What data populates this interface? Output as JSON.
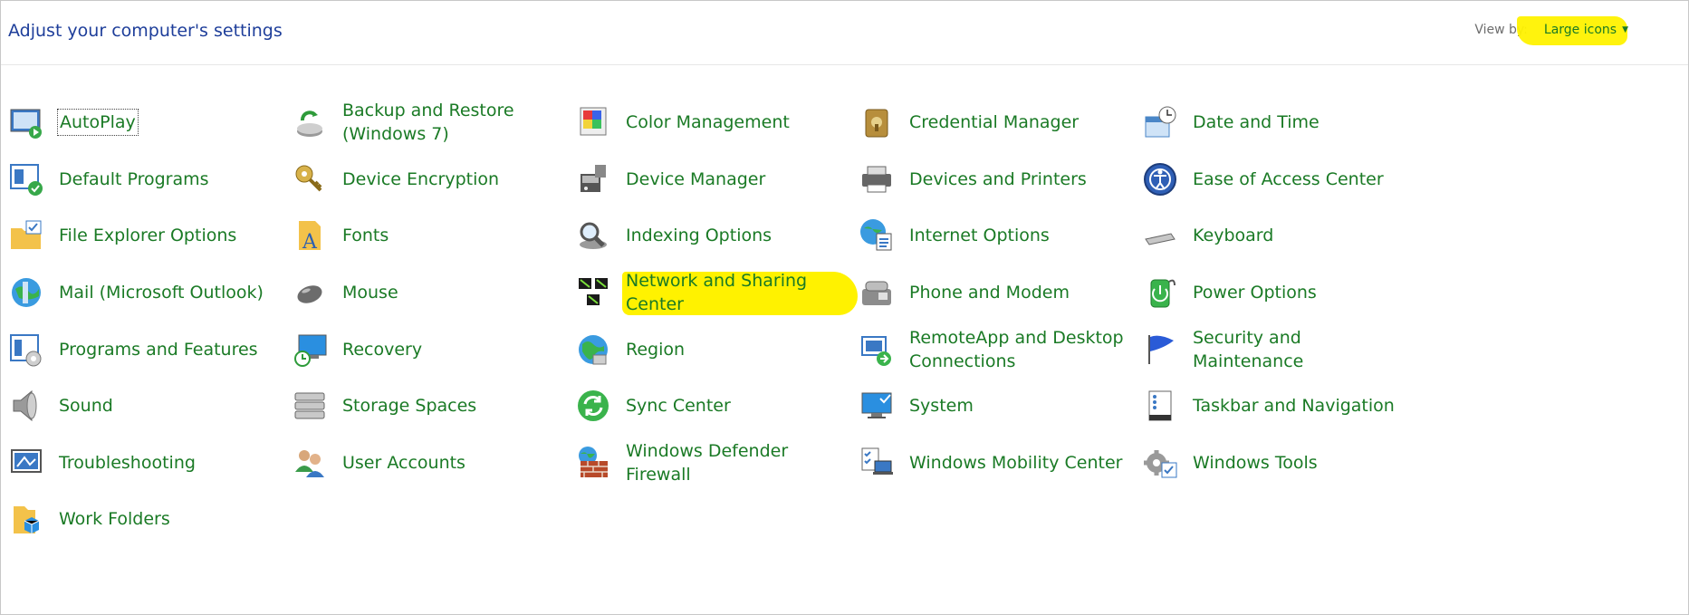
{
  "header": {
    "title": "Adjust your computer's settings",
    "view_by_label": "View by:",
    "view_by_value": "Large icons"
  },
  "colors": {
    "link": "#1a7a25",
    "title": "#1e3e9a",
    "highlight": "#fff200"
  },
  "items": [
    {
      "label": "AutoPlay",
      "icon": "autoplay-icon"
    },
    {
      "label": "Backup and Restore (Windows 7)",
      "icon": "backup-restore-icon"
    },
    {
      "label": "Color Management",
      "icon": "color-management-icon"
    },
    {
      "label": "Credential Manager",
      "icon": "credential-manager-icon"
    },
    {
      "label": "Date and Time",
      "icon": "date-time-icon"
    },
    {
      "label": "Default Programs",
      "icon": "default-programs-icon"
    },
    {
      "label": "Device Encryption",
      "icon": "device-encryption-icon"
    },
    {
      "label": "Device Manager",
      "icon": "device-manager-icon"
    },
    {
      "label": "Devices and Printers",
      "icon": "devices-printers-icon"
    },
    {
      "label": "Ease of Access Center",
      "icon": "ease-of-access-icon"
    },
    {
      "label": "File Explorer Options",
      "icon": "file-explorer-options-icon"
    },
    {
      "label": "Fonts",
      "icon": "fonts-icon"
    },
    {
      "label": "Indexing Options",
      "icon": "indexing-options-icon"
    },
    {
      "label": "Internet Options",
      "icon": "internet-options-icon"
    },
    {
      "label": "Keyboard",
      "icon": "keyboard-icon"
    },
    {
      "label": "Mail (Microsoft Outlook)",
      "icon": "mail-icon"
    },
    {
      "label": "Mouse",
      "icon": "mouse-icon"
    },
    {
      "label": "Network and Sharing Center",
      "icon": "network-sharing-icon"
    },
    {
      "label": "Phone and Modem",
      "icon": "phone-modem-icon"
    },
    {
      "label": "Power Options",
      "icon": "power-options-icon"
    },
    {
      "label": "Programs and Features",
      "icon": "programs-features-icon"
    },
    {
      "label": "Recovery",
      "icon": "recovery-icon"
    },
    {
      "label": "Region",
      "icon": "region-icon"
    },
    {
      "label": "RemoteApp and Desktop Connections",
      "icon": "remoteapp-icon"
    },
    {
      "label": "Security and Maintenance",
      "icon": "security-maintenance-icon"
    },
    {
      "label": "Sound",
      "icon": "sound-icon"
    },
    {
      "label": "Storage Spaces",
      "icon": "storage-spaces-icon"
    },
    {
      "label": "Sync Center",
      "icon": "sync-center-icon"
    },
    {
      "label": "System",
      "icon": "system-icon"
    },
    {
      "label": "Taskbar and Navigation",
      "icon": "taskbar-navigation-icon"
    },
    {
      "label": "Troubleshooting",
      "icon": "troubleshooting-icon"
    },
    {
      "label": "User Accounts",
      "icon": "user-accounts-icon"
    },
    {
      "label": "Windows Defender Firewall",
      "icon": "firewall-icon"
    },
    {
      "label": "Windows Mobility Center",
      "icon": "mobility-center-icon"
    },
    {
      "label": "Windows Tools",
      "icon": "windows-tools-icon"
    },
    {
      "label": "Work Folders",
      "icon": "work-folders-icon"
    }
  ]
}
